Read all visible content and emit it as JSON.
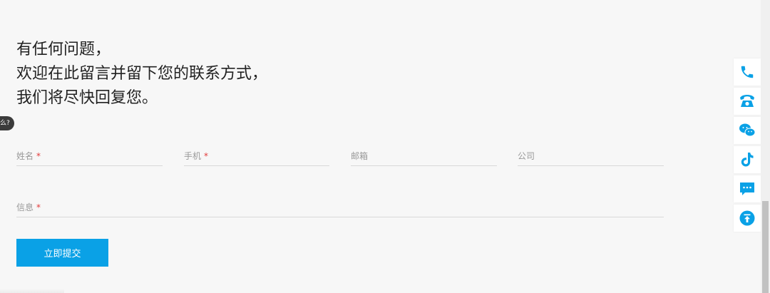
{
  "headline": {
    "line1": "有任何问题，",
    "line2": "欢迎在此留言并留下您的联系方式，",
    "line3": "我们将尽快回复您。"
  },
  "side_tip": {
    "text": "么?"
  },
  "form": {
    "name": {
      "label": "姓名",
      "required_mark": "*"
    },
    "phone": {
      "label": "手机",
      "required_mark": "*"
    },
    "email": {
      "label": "邮箱"
    },
    "company": {
      "label": "公司"
    },
    "message": {
      "label": "信息",
      "required_mark": "*"
    },
    "submit_label": "立即提交"
  },
  "float_bar": {
    "items": [
      {
        "icon": "phone-icon"
      },
      {
        "icon": "telephone-icon"
      },
      {
        "icon": "wechat-icon"
      },
      {
        "icon": "tiktok-icon"
      },
      {
        "icon": "message-icon"
      },
      {
        "icon": "back-to-top-icon"
      }
    ]
  },
  "colors": {
    "accent": "#0aa1e6",
    "required": "#e23b3b"
  }
}
